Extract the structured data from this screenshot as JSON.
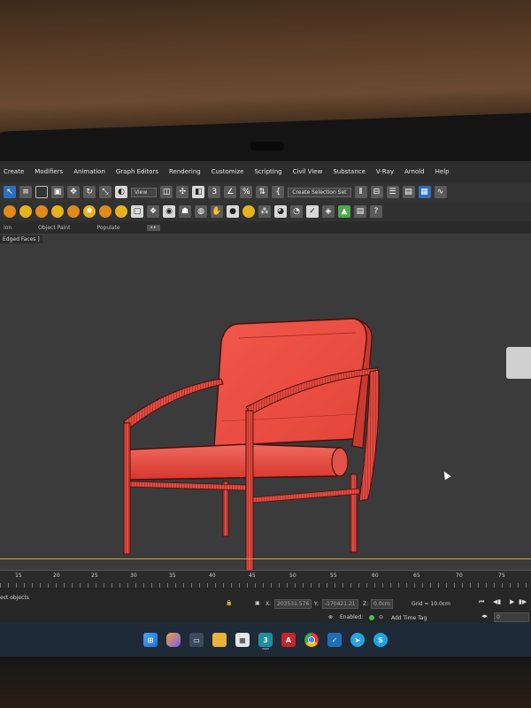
{
  "menu": {
    "items": [
      "Create",
      "Modifiers",
      "Animation",
      "Graph Editors",
      "Rendering",
      "Customize",
      "Scripting",
      "Civil View",
      "Substance",
      "V-Ray",
      "Arnold",
      "Help"
    ],
    "selection_set": "Create Selection Set"
  },
  "toolbar": {
    "view_dropdown": "View"
  },
  "ribbon": {
    "tabs": [
      "ion",
      "Object Paint",
      "Populate"
    ],
    "more": "••"
  },
  "viewport": {
    "label": "Edged Faces ]",
    "object_color": "#e8483f"
  },
  "timeline": {
    "ticks": [
      "15",
      "20",
      "25",
      "30",
      "35",
      "40",
      "45",
      "50",
      "55",
      "60",
      "65",
      "70",
      "75"
    ]
  },
  "status": {
    "prompt": "ect objects",
    "x_label": "X:",
    "x_value": "203531.576",
    "y_label": "Y:",
    "y_value": "-170421.21",
    "z_label": "Z:",
    "z_value": "0.0cm",
    "grid": "Grid = 10.0cm",
    "enabled_label": "Enabled:",
    "add_time_tag": "Add Time Tag",
    "frame_value": "0"
  },
  "taskbar": {
    "apps": [
      "windows-start",
      "copilot",
      "dev-home",
      "file-explorer",
      "calendar",
      "3ds-max",
      "acrobat",
      "chrome",
      "vray",
      "telegram",
      "skype"
    ],
    "max_badge": "3",
    "max_sub": "2023",
    "acro_letter": "A"
  }
}
